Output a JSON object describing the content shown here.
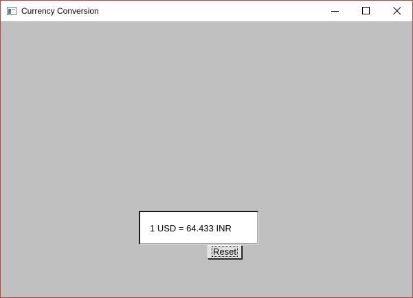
{
  "window": {
    "title": "Currency Conversion",
    "controls": {
      "minimize": "minimize-icon",
      "maximize": "maximize-icon",
      "close": "close-icon"
    }
  },
  "converter": {
    "result_text": "1 USD = 64.433 INR",
    "reset_label": "Reset"
  },
  "colors": {
    "client_background": "#c0c0c0",
    "window_border": "#b4473b"
  }
}
